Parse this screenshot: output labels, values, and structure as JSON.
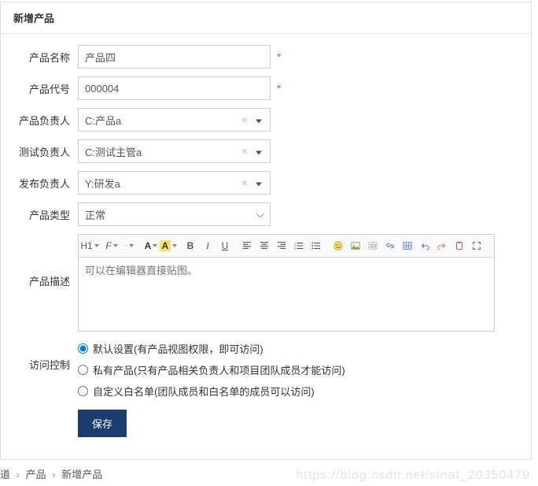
{
  "panel": {
    "title": "新增产品"
  },
  "form": {
    "name": {
      "label": "产品名称",
      "value": "产品四",
      "required": "*"
    },
    "code": {
      "label": "产品代号",
      "value": "000004",
      "required": "*"
    },
    "owner": {
      "label": "产品负责人",
      "value": "C:产品a"
    },
    "tester": {
      "label": "测试负责人",
      "value": "C:测试主管a"
    },
    "release": {
      "label": "发布负责人",
      "value": "Y:研发a"
    },
    "type": {
      "label": "产品类型",
      "value": "正常"
    },
    "desc": {
      "label": "产品描述",
      "placeholder": "可以在编辑器直接贴图。"
    },
    "access": {
      "label": "访问控制",
      "opt1": "默认设置(有产品视图权限，即可访问)",
      "opt2": "私有产品(只有产品相关负责人和项目团队成员才能访问)",
      "opt3": "自定义白名单(团队成员和白名单的成员可以访问)"
    },
    "save": "保存"
  },
  "toolbar": {
    "h1": "H1",
    "strike": "F",
    "fontA": "A",
    "hlA": "A",
    "bold": "B",
    "italic": "I",
    "underline": "U"
  },
  "breadcrumb": {
    "seg0": "道",
    "sep": "›",
    "seg1": "产品",
    "seg2": "新增产品"
  },
  "watermark": "https://blog.csdn.net/sinat_20350479"
}
